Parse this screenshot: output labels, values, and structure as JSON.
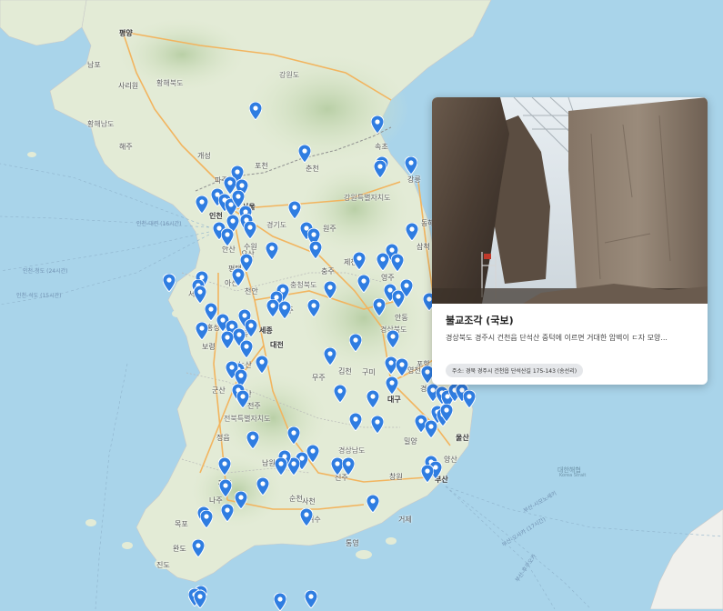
{
  "map": {
    "region_labels": [
      {
        "id": "hwanghae-bukdo",
        "text": "황해북도"
      },
      {
        "id": "hwanghae-namdo",
        "text": "황해남도"
      },
      {
        "id": "gangwon-do-north",
        "text": "강원도"
      },
      {
        "id": "gangwon-special",
        "text": "강원특별자치도"
      },
      {
        "id": "gyeonggi",
        "text": "경기도"
      },
      {
        "id": "chungbuk",
        "text": "충청북도"
      },
      {
        "id": "gyeongbuk",
        "text": "경상북도"
      },
      {
        "id": "jeonbuk",
        "text": "전북특별자치도"
      },
      {
        "id": "gyeongnam",
        "text": "경상남도"
      }
    ],
    "city_labels": [
      {
        "id": "pyongyang",
        "text": "평양"
      },
      {
        "id": "nampo",
        "text": "남포"
      },
      {
        "id": "sariwon",
        "text": "사리원"
      },
      {
        "id": "haeju",
        "text": "해주"
      },
      {
        "id": "kaesong",
        "text": "개성"
      },
      {
        "id": "incheon",
        "text": "인천"
      },
      {
        "id": "seoul",
        "text": "서울"
      },
      {
        "id": "chuncheon",
        "text": "춘천"
      },
      {
        "id": "gangneung",
        "text": "강릉"
      },
      {
        "id": "wonju",
        "text": "원주"
      },
      {
        "id": "suwon",
        "text": "수원"
      },
      {
        "id": "cheonan",
        "text": "천안"
      },
      {
        "id": "cheongju",
        "text": "청주"
      },
      {
        "id": "sejong",
        "text": "세종"
      },
      {
        "id": "daejeon",
        "text": "대전"
      },
      {
        "id": "jeonju",
        "text": "전주"
      },
      {
        "id": "gwangju",
        "text": "광주"
      },
      {
        "id": "daegu",
        "text": "대구"
      },
      {
        "id": "ulsan",
        "text": "울산"
      },
      {
        "id": "busan",
        "text": "부산"
      },
      {
        "id": "mokpo",
        "text": "목포"
      },
      {
        "id": "andong",
        "text": "안동"
      },
      {
        "id": "pohang",
        "text": "포항"
      },
      {
        "id": "gimcheon",
        "text": "김천"
      },
      {
        "id": "gumi",
        "text": "구미"
      },
      {
        "id": "gyeongju",
        "text": "경주"
      },
      {
        "id": "changwon",
        "text": "창원"
      },
      {
        "id": "jinju",
        "text": "진주"
      },
      {
        "id": "suncheon",
        "text": "순천"
      },
      {
        "id": "yeosu",
        "text": "여수"
      },
      {
        "id": "naju",
        "text": "나주"
      },
      {
        "id": "gunsan",
        "text": "군산"
      },
      {
        "id": "iksan",
        "text": "익산"
      },
      {
        "id": "boryeong",
        "text": "보령"
      },
      {
        "id": "seosan",
        "text": "서산"
      },
      {
        "id": "asan",
        "text": "아산"
      },
      {
        "id": "chungju",
        "text": "충주"
      },
      {
        "id": "jecheon",
        "text": "제천"
      },
      {
        "id": "yeongju",
        "text": "영주"
      },
      {
        "id": "samcheok",
        "text": "삼척"
      },
      {
        "id": "donghae",
        "text": "동해"
      },
      {
        "id": "sacheon",
        "text": "사천"
      },
      {
        "id": "geoje",
        "text": "거제"
      },
      {
        "id": "tongyeong",
        "text": "통영"
      },
      {
        "id": "wando",
        "text": "완도"
      },
      {
        "id": "jindo",
        "text": "진도"
      },
      {
        "id": "sokcho",
        "text": "속초"
      },
      {
        "id": "pocheon",
        "text": "포천"
      },
      {
        "id": "paju",
        "text": "파주"
      },
      {
        "id": "gimpo",
        "text": "김포"
      },
      {
        "id": "pyeongtaek",
        "text": "평택"
      },
      {
        "id": "osan",
        "text": "오산"
      },
      {
        "id": "ansan",
        "text": "안산"
      },
      {
        "id": "hongseong",
        "text": "홍성"
      },
      {
        "id": "gongju",
        "text": "공주"
      },
      {
        "id": "nonsan",
        "text": "논산"
      },
      {
        "id": "yeongcheon",
        "text": "영천"
      },
      {
        "id": "miryang",
        "text": "밀양"
      },
      {
        "id": "gimhae",
        "text": "김해"
      },
      {
        "id": "yangsan",
        "text": "양산"
      },
      {
        "id": "jeongeup",
        "text": "정읍"
      },
      {
        "id": "namwon",
        "text": "남원"
      },
      {
        "id": "muju",
        "text": "무주"
      }
    ],
    "sea_labels": [
      {
        "id": "east-sea",
        "text": "대한해협"
      },
      {
        "id": "korea-strait",
        "text": "Korea Strait"
      }
    ],
    "ferry_labels": [
      {
        "id": "ferry-1",
        "text": "인천-대련 (16시간)"
      },
      {
        "id": "ferry-2",
        "text": "인천-청도 (24시간)"
      },
      {
        "id": "ferry-3",
        "text": "인천-석도 (15시간)"
      },
      {
        "id": "ferry-4",
        "text": "부산-시모노세키"
      },
      {
        "id": "ferry-5",
        "text": "부산-오사카 (17시간)"
      },
      {
        "id": "ferry-6",
        "text": "부산-후쿠오카"
      }
    ],
    "marker_count": 142,
    "colors": {
      "sea": "#a9d4ea",
      "land": "#dfe9d2",
      "mountain": "#c7d9b8",
      "road": "#f3b35a",
      "border": "#9b9b9b",
      "marker": "#2f7de1"
    }
  },
  "popup": {
    "title": "불교조각 (국보)",
    "description": "경상북도 경주시 건천읍 단석산 중턱에 이르면 거대한 암벽이 ㄷ자 모양...",
    "address": "주소: 경북 경주시 건천읍 단석산길 175-143 (송선리)"
  }
}
